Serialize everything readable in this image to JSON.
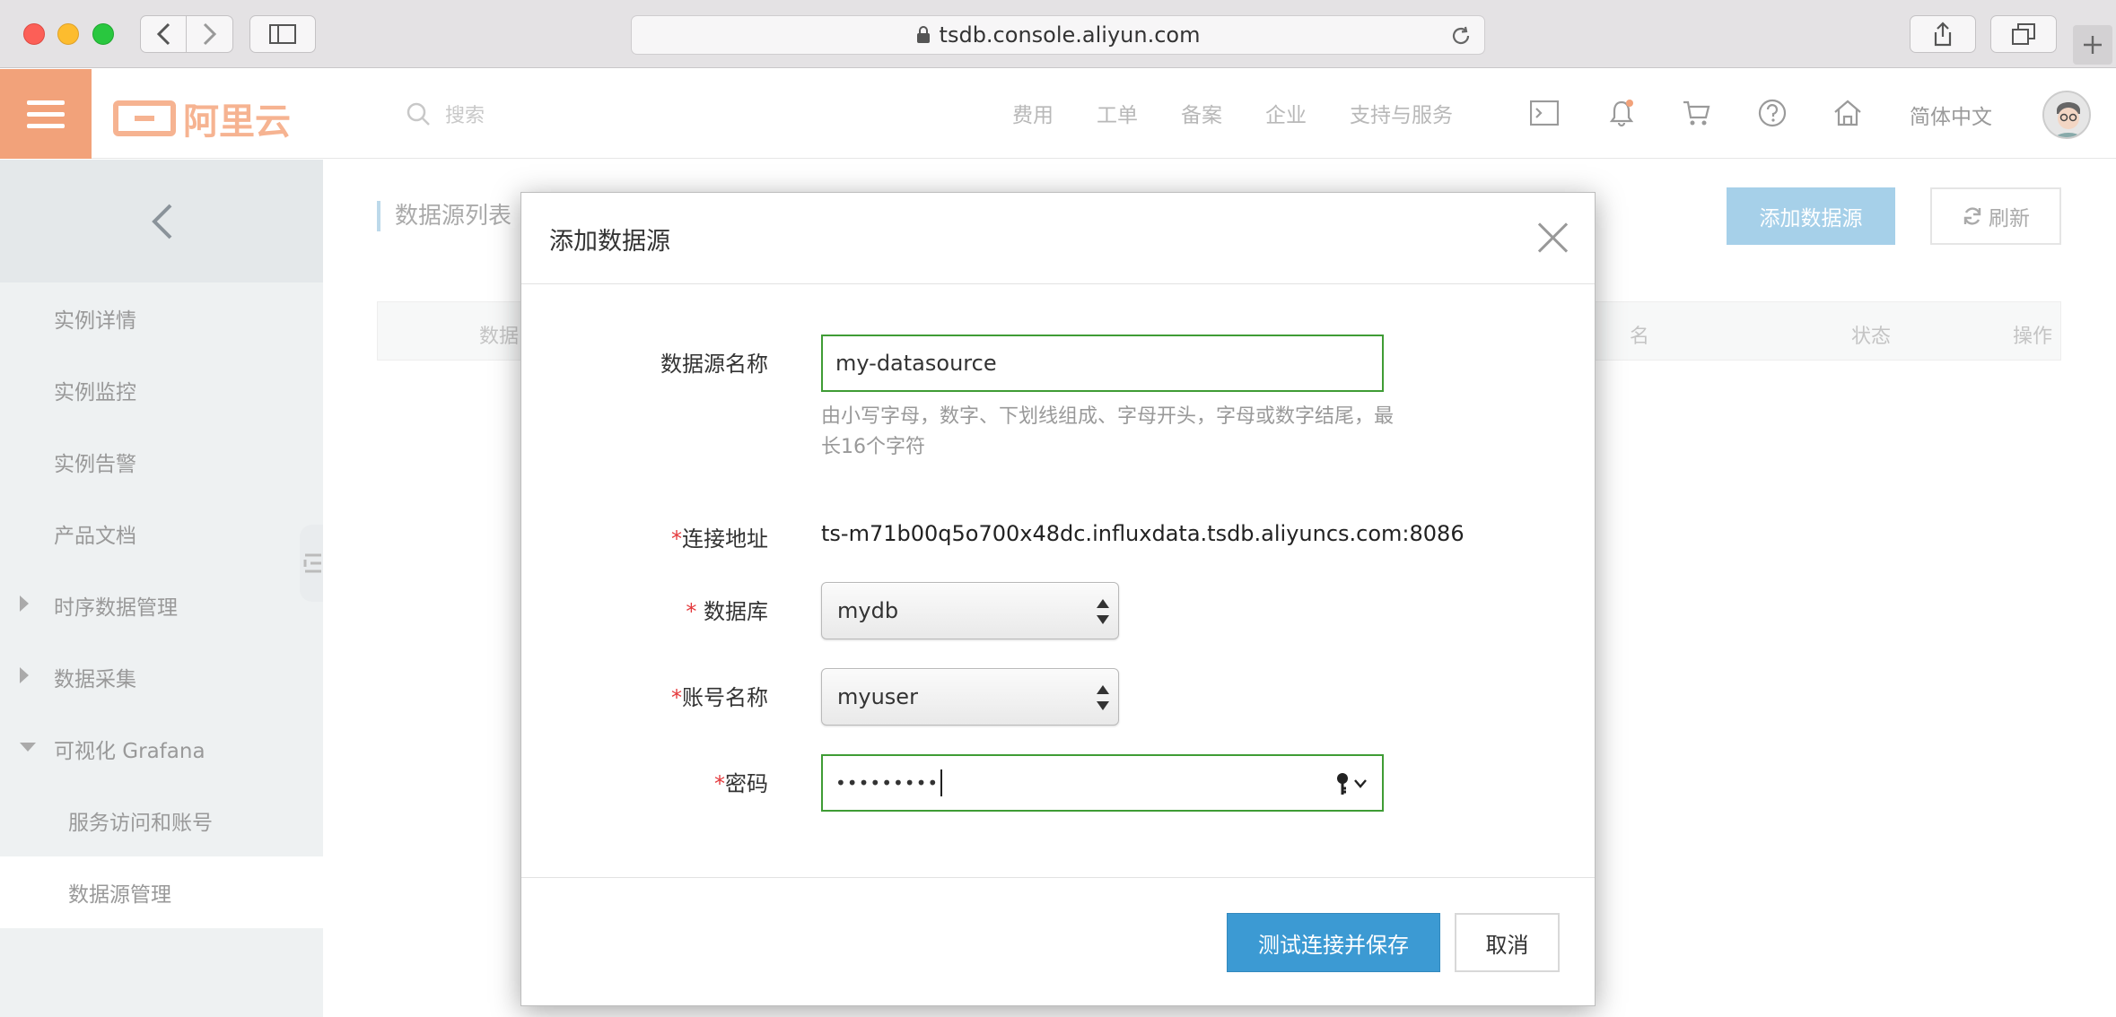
{
  "browser": {
    "url": "tsdb.console.aliyun.com"
  },
  "topbar": {
    "logo_text": "阿里云",
    "search_placeholder": "搜索",
    "nav": [
      "费用",
      "工单",
      "备案",
      "企业",
      "支持与服务"
    ],
    "language": "简体中文",
    "icons": [
      "terminal-icon",
      "bell-icon",
      "cart-icon",
      "help-icon",
      "home-icon"
    ]
  },
  "sidebar": {
    "items": [
      {
        "label": "实例详情"
      },
      {
        "label": "实例监控"
      },
      {
        "label": "实例告警"
      },
      {
        "label": "产品文档"
      },
      {
        "label": "时序数据管理"
      },
      {
        "label": "数据采集"
      },
      {
        "label": "可视化 Grafana"
      },
      {
        "label": "服务访问和账号"
      },
      {
        "label": "数据源管理"
      }
    ]
  },
  "content": {
    "list_title": "数据源列表",
    "add_button": "添加数据源",
    "refresh_button": "刷新",
    "table_headers": {
      "name": "数据",
      "hidden": "名",
      "status": "状态",
      "action": "操作"
    }
  },
  "modal": {
    "title": "添加数据源",
    "fields": {
      "name_label": "数据源名称",
      "name_value": "my-datasource",
      "name_hint": "由小写字母，数字、下划线组成、字母开头，字母或数字结尾，最长16个字符",
      "address_label": "连接地址",
      "address_value": "ts-m71b00q5o700x48dc.influxdata.tsdb.aliyuncs.com:8086",
      "database_label": "数据库",
      "database_value": "mydb",
      "account_label": "账号名称",
      "account_value": "myuser",
      "password_label": "密码",
      "password_mask": "•••••••••"
    },
    "required_mark": "*",
    "submit_button": "测试连接并保存",
    "cancel_button": "取消"
  },
  "colors": {
    "brand_orange": "#f2a27a",
    "primary_blue": "#3c9ad3",
    "focus_green": "#3f9c35",
    "required_red": "#e4393c"
  }
}
